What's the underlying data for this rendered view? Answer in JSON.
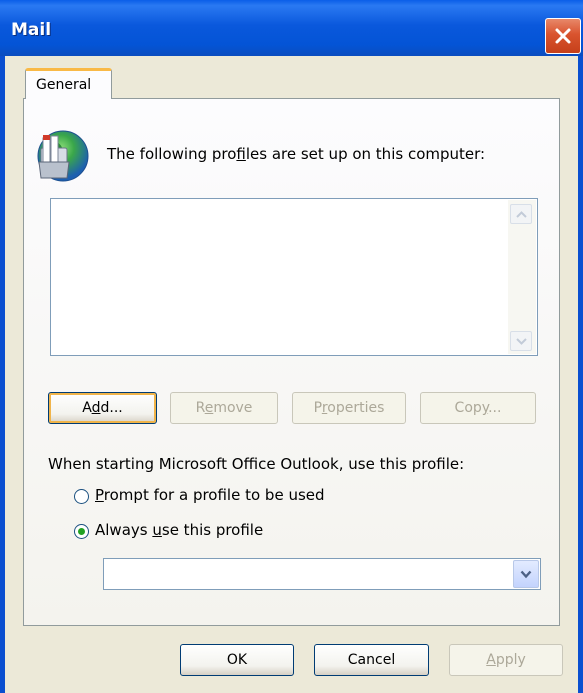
{
  "window": {
    "title": "Mail",
    "close_icon": "close-icon"
  },
  "tabs": [
    {
      "label": "General",
      "selected": true
    }
  ],
  "profiles": {
    "intro_text_before": "The following pro",
    "intro_text_mnemonic": "f",
    "intro_text_after": "iles are set up on this computer:",
    "items": []
  },
  "buttons": {
    "add": {
      "before": "A",
      "mnemonic": "d",
      "after": "d...",
      "enabled": true
    },
    "remove": {
      "before": "R",
      "mnemonic": "e",
      "after": "move",
      "enabled": false
    },
    "properties": {
      "before": "P",
      "mnemonic": "r",
      "after": "operties",
      "enabled": false
    },
    "copy": {
      "before": "Cop",
      "mnemonic": "y",
      "after": "...",
      "enabled": false
    }
  },
  "startup": {
    "label": "When starting Microsoft Office Outlook, use this profile:",
    "options": [
      {
        "before": "",
        "mnemonic": "P",
        "after": "rompt for a profile to be used",
        "checked": false
      },
      {
        "before": "Always ",
        "mnemonic": "u",
        "after": "se this profile",
        "checked": true
      }
    ],
    "profile_combo_value": ""
  },
  "footer": {
    "ok": "OK",
    "cancel": "Cancel",
    "apply_before": "",
    "apply_mnemonic": "A",
    "apply_after": "pply"
  },
  "colors": {
    "title_bar": "#0a58dc",
    "dialog_bg": "#ece9d8",
    "tab_highlight": "#f9b946",
    "radio_checked": "#21a121"
  }
}
